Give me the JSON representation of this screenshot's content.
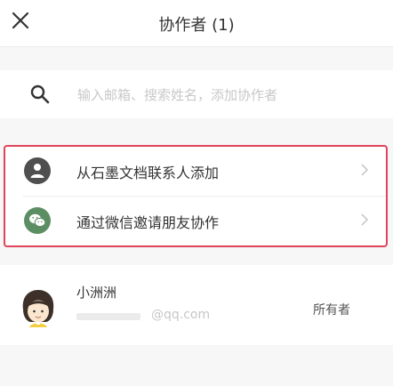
{
  "header": {
    "title": "协作者 (1)",
    "close_icon": "close-icon"
  },
  "search": {
    "icon": "search-icon",
    "placeholder": "输入邮箱、搜索姓名，添加协作者",
    "value": ""
  },
  "add_options": [
    {
      "label": "从石墨文档联系人添加",
      "icon": "person-icon"
    },
    {
      "label": "通过微信邀请朋友协作",
      "icon": "wechat-icon"
    }
  ],
  "members": [
    {
      "name": "小洲洲",
      "email_domain": "@qq.com",
      "role": "所有者"
    }
  ],
  "colors": {
    "highlight_border": "#e0445a",
    "wechat_green": "#5c8e63",
    "person_gray": "#4f4f4f"
  }
}
